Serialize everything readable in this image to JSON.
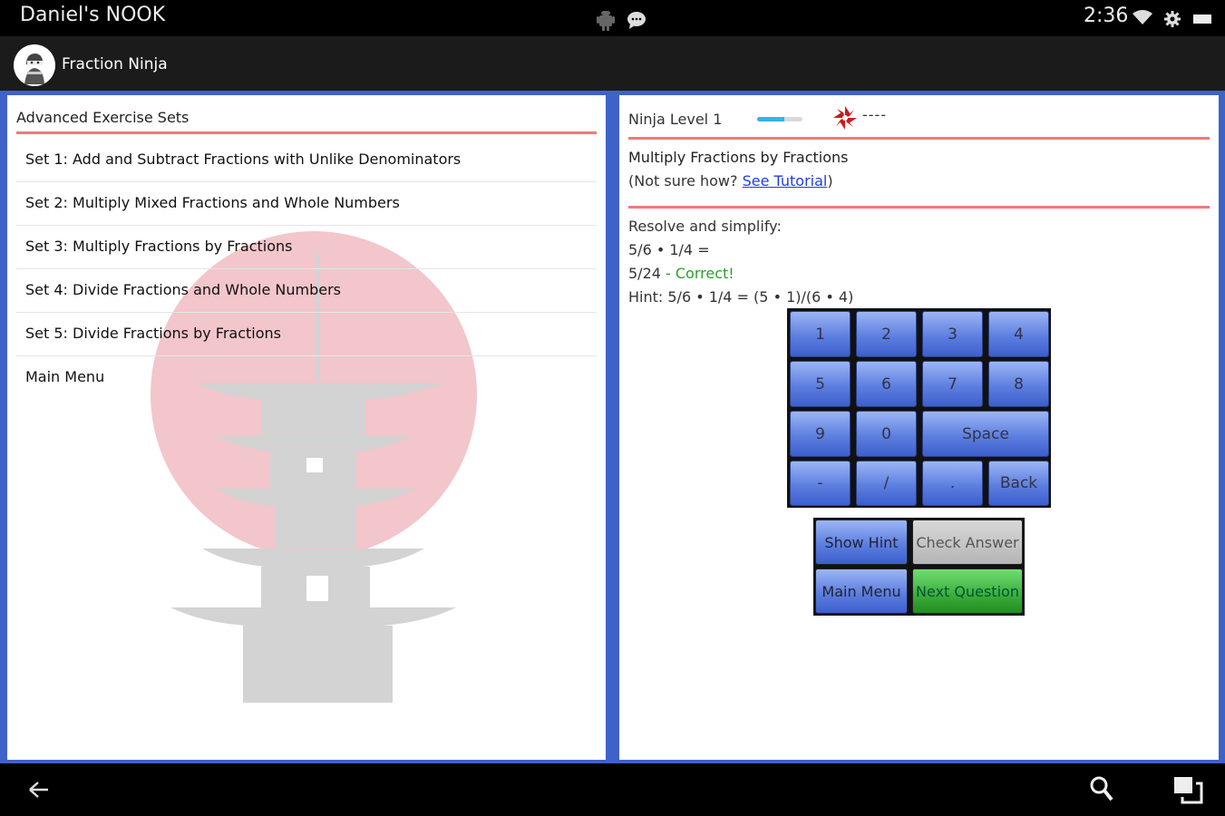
{
  "status_bar": {
    "device_name": "Daniel's NOOK",
    "time": "2:36",
    "icons": [
      "android-icon",
      "chat-icon",
      "wifi-icon",
      "settings-icon",
      "battery-icon"
    ]
  },
  "action_bar": {
    "app_title": "Fraction Ninja",
    "logo_icon": "ninja-logo-icon"
  },
  "left_panel": {
    "header": "Advanced Exercise Sets",
    "items": [
      {
        "label": "Set 1: Add and Subtract Fractions with Unlike Denominators"
      },
      {
        "label": "Set 2: Multiply Mixed Fractions and Whole Numbers"
      },
      {
        "label": "Set 3: Multiply Fractions by Fractions"
      },
      {
        "label": "Set 4: Divide Fractions and Whole Numbers"
      },
      {
        "label": "Set 5: Divide Fractions by Fractions"
      },
      {
        "label": "Main Menu"
      }
    ],
    "background_icon": "pagoda-sun-icon"
  },
  "right_panel": {
    "level_label": "Ninja Level 1",
    "level_progress": 0.6,
    "shuriken_icon": "shuriken-icon",
    "stars": "----",
    "topic_title": "Multiply Fractions by Fractions",
    "not_sure_prefix": "(Not sure how? ",
    "tutorial_link": "See Tutorial",
    "not_sure_suffix": ")",
    "instruction": "Resolve and simplify:",
    "problem": "5/6 • 1/4 =",
    "answer": "5/24",
    "answer_status": " - Correct!",
    "hint": "Hint: 5/6 • 1/4 = (5 • 1)/(6 • 4)",
    "keypad": {
      "k1": "1",
      "k2": "2",
      "k3": "3",
      "k4": "4",
      "k5": "5",
      "k6": "6",
      "k7": "7",
      "k8": "8",
      "k9": "9",
      "k0": "0",
      "space": "Space",
      "minus": "-",
      "slash": "/",
      "dot": ".",
      "back": "Back"
    },
    "actions": {
      "show_hint": "Show Hint",
      "check_answer": "Check Answer",
      "main_menu": "Main Menu",
      "next_question": "Next Question"
    }
  },
  "nav_bar": {
    "icons": [
      "back-arrow-icon",
      "search-icon",
      "recent-apps-icon"
    ]
  },
  "colors": {
    "panel_border": "#3f62c9",
    "rule_red": "#f07878",
    "correct_green": "#2aa12a",
    "key_blue": "#5d7fe0",
    "next_green": "#3fb03f"
  }
}
